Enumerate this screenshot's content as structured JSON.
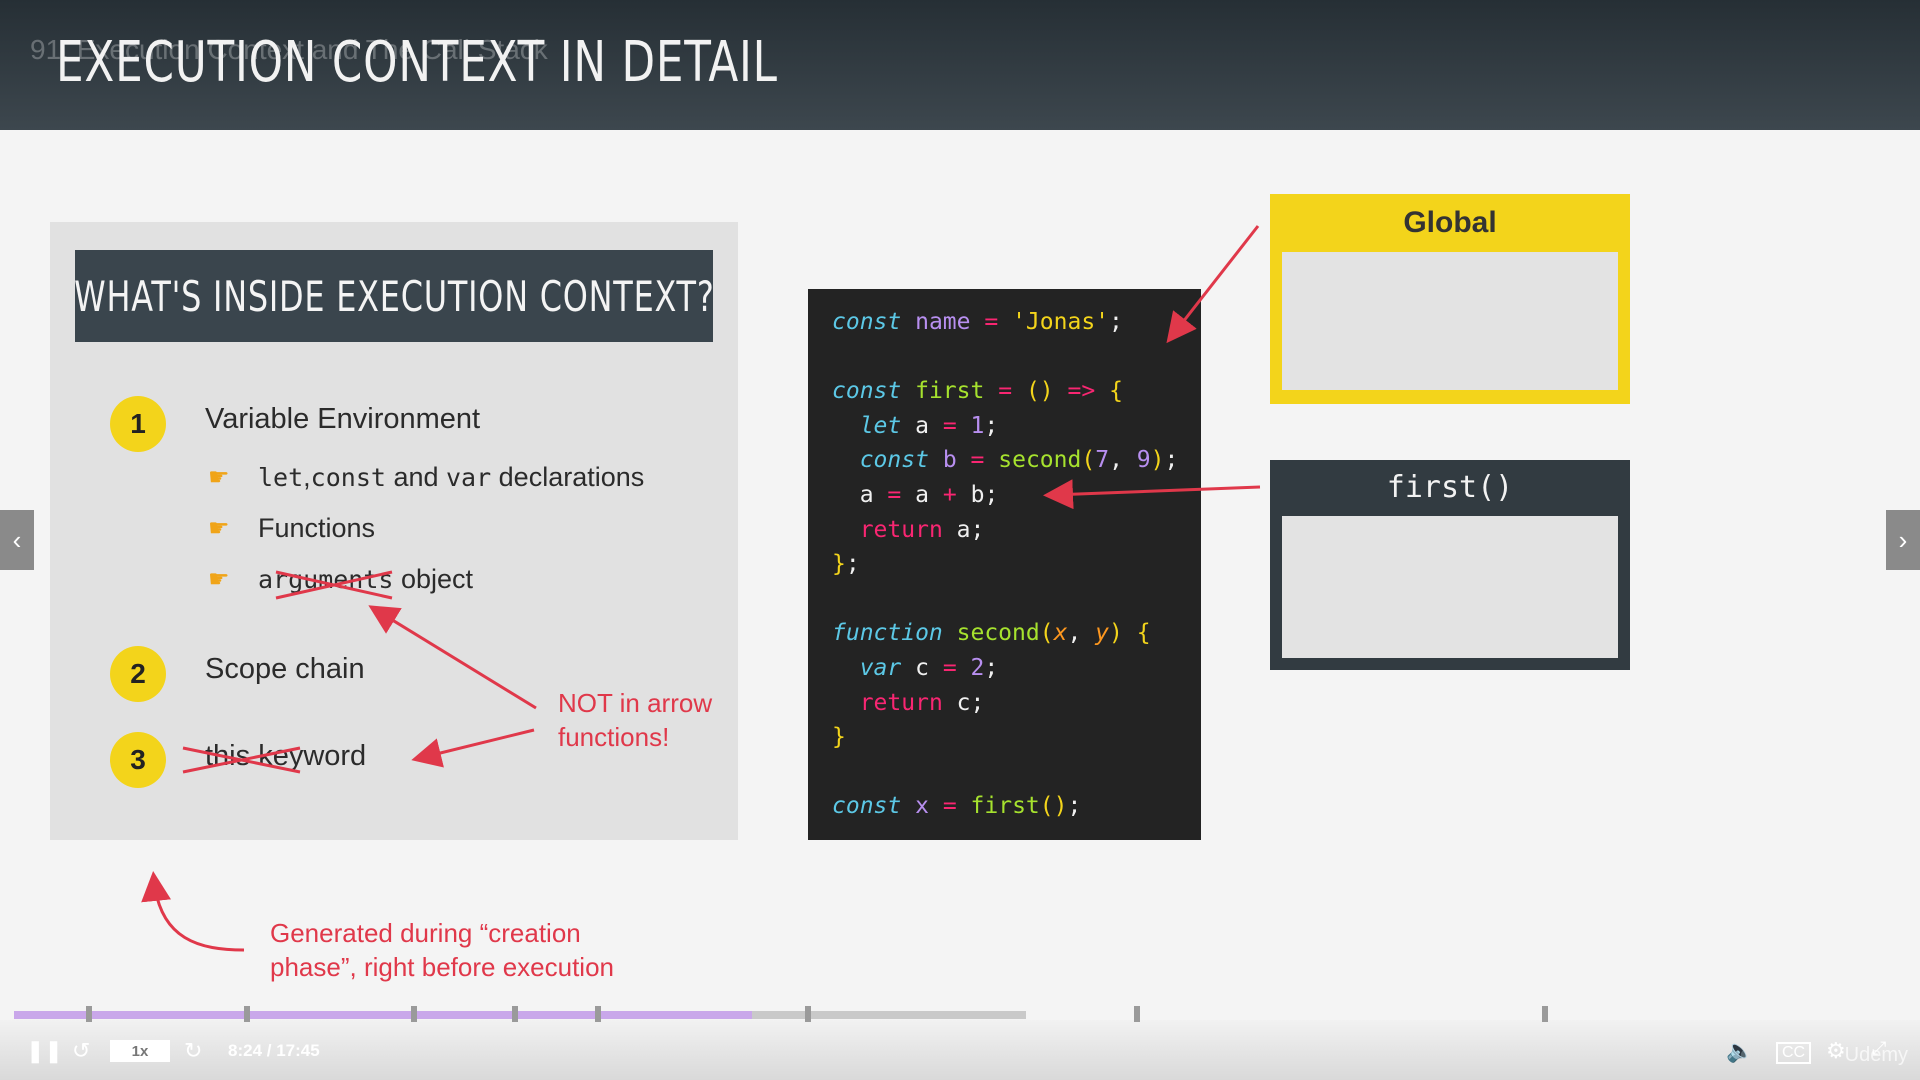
{
  "lecture_title": "91. Execution Context and The Call Stack",
  "slide_title": "EXECUTION CONTEXT IN DETAIL",
  "panel": {
    "heading": "WHAT'S INSIDE EXECUTION CONTEXT?",
    "items": [
      {
        "number": "1",
        "label": "Variable Environment"
      },
      {
        "number": "2",
        "label": "Scope chain"
      },
      {
        "number": "3",
        "label_struck": "this",
        "label_rest": " keyword"
      }
    ],
    "sub_items": {
      "decl_let": "let",
      "decl_sep": ", ",
      "decl_const": "const",
      "decl_and": " and ",
      "decl_var": "var",
      "decl_rest": " declarations",
      "functions": "Functions",
      "args_struck": "arguments",
      "args_rest": " object"
    }
  },
  "notes": {
    "arrow_functions_line1": "NOT in arrow",
    "arrow_functions_line2": "functions!",
    "creation_line1": "Generated during “creation",
    "creation_line2": "phase”, right before execution"
  },
  "stack": {
    "global_label": "Global",
    "first_label": "first()"
  },
  "player": {
    "speed": "1x",
    "time": "8:24 / 17:45",
    "brand": "Udemy",
    "progress_fraction": 0.729
  },
  "colors": {
    "accent_yellow": "#f3d41b",
    "annotation_red": "#e0384a",
    "dark_slate": "#3a454d",
    "code_bg": "#232323"
  }
}
